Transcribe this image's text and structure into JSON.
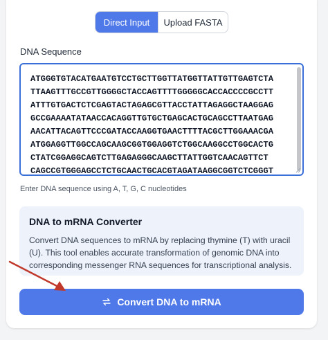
{
  "tabs": {
    "direct_input": "Direct Input",
    "upload_fasta": "Upload FASTA"
  },
  "sequence": {
    "label": "DNA Sequence",
    "value": "ATGGGTGTACATGAATGTCCTGCTTGGTTATGGTTATTGTTGAGTCTA\nTTAAGTTTGCCGTTGGGGCTACCAGTTTTGGGGGCACCACCCCGCCTT\nATTTGTGACTCTCGAGTACTAGAGCGTTACCTATTAGAGGCTAAGGAG\nGCCGAAAATATAACCACAGGTTGTGCTGAGCACTGCAGCCTTAATGAG\nAACATTACAGTTCCCGATACCAAGGTGAACTTTTACGCTTGGAAACGA\nATGGAGGTTGGCCAGCAAGCGGTGGAGGTCTGGCAAGGCCTGGCACTG\nCTATCGGAGGCAGTCTTGAGAGGGCAAGCTTATTGGTCAACAGTTCT\nCAGCCGTGGGAGCCTCTGCAACTGCACGTAGATAAGGCGGTCTCGGGT",
    "hint": "Enter DNA sequence using A, T, G, C nucleotides"
  },
  "info": {
    "title": "DNA to mRNA Converter",
    "description": "Convert DNA sequences to mRNA by replacing thymine (T) with uracil (U). This tool enables accurate transformation of genomic DNA into corresponding messenger RNA sequences for transcriptional analysis."
  },
  "convert_button": {
    "label": "Convert DNA to mRNA",
    "icon": "swap-arrows-icon"
  },
  "colors": {
    "accent": "#4f79e8",
    "annotation_arrow": "#c0392b"
  }
}
